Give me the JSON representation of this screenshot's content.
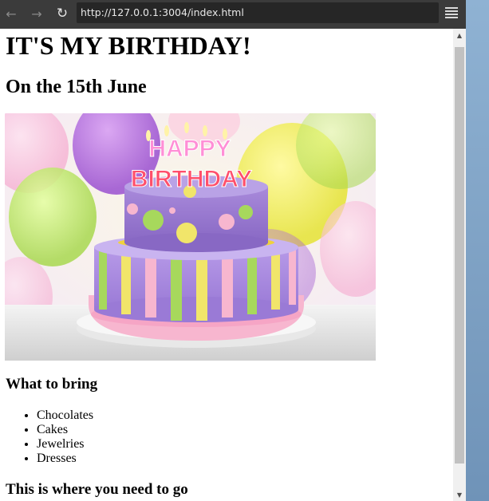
{
  "browser": {
    "url": "http://127.0.0.1:3004/index.html",
    "back_icon": "arrow-left",
    "forward_icon": "arrow-right",
    "reload_icon": "reload",
    "menu_icon": "hamburger-menu"
  },
  "page": {
    "title": "IT'S MY BIRTHDAY!",
    "subtitle": "On the 15th June",
    "image": {
      "cake_text_line1": "HAPPY",
      "cake_text_line2": "BIRTHDAY"
    },
    "bring_heading": "What to bring",
    "bring_items": [
      "Chocolates",
      "Cakes",
      "Jewelries",
      "Dresses"
    ],
    "location_heading": "This is where you need to go"
  },
  "colors": {
    "toolbar": "#3b3b3b",
    "urlbar": "#262626",
    "scrollbar_thumb": "#c1c1c1"
  }
}
